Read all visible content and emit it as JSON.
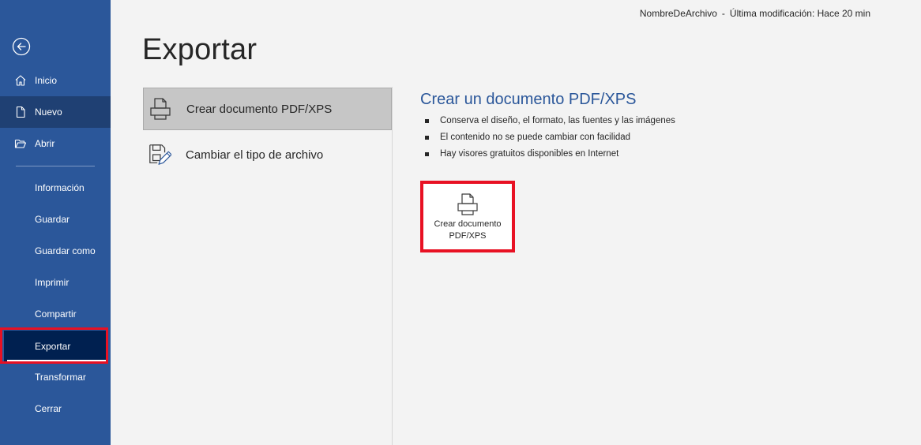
{
  "header": {
    "file_name": "NombreDeArchivo",
    "separator": "-",
    "modified": "Última modificación: Hace 20 min"
  },
  "sidebar": {
    "items": [
      {
        "label": "Inicio",
        "icon": "home-icon"
      },
      {
        "label": "Nuevo",
        "icon": "new-document-icon"
      },
      {
        "label": "Abrir",
        "icon": "open-folder-icon"
      },
      {
        "label": "Información"
      },
      {
        "label": "Guardar"
      },
      {
        "label": "Guardar como"
      },
      {
        "label": "Imprimir"
      },
      {
        "label": "Compartir"
      },
      {
        "label": "Exportar"
      },
      {
        "label": "Transformar"
      },
      {
        "label": "Cerrar"
      }
    ]
  },
  "page": {
    "title": "Exportar"
  },
  "options": [
    {
      "label": "Crear documento PDF/XPS",
      "icon": "pdf-document-icon"
    },
    {
      "label": "Cambiar el tipo de archivo",
      "icon": "change-file-type-icon"
    }
  ],
  "panel": {
    "title": "Crear un documento PDF/XPS",
    "bullets": [
      "Conserva el diseño, el formato, las fuentes y las imágenes",
      "El contenido no se puede cambiar con facilidad",
      "Hay visores gratuitos disponibles en Internet"
    ],
    "button_line1": "Crear documento",
    "button_line2": "PDF/XPS"
  },
  "colors": {
    "sidebar": "#2b579a",
    "sidebar_selected": "#1f4073",
    "export_active": "#002050",
    "highlight": "#e81123",
    "accent_text": "#2b579a"
  }
}
